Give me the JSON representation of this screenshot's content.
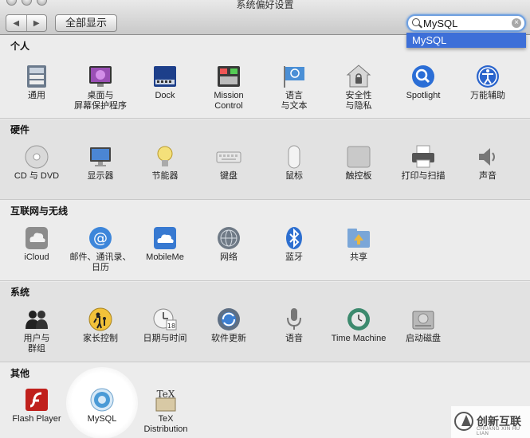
{
  "window": {
    "title": "系统偏好设置"
  },
  "toolbar": {
    "back": "◀",
    "forward": "▶",
    "show_all": "全部显示"
  },
  "search": {
    "value": "MySQL",
    "clear": "×",
    "result": "MySQL"
  },
  "sections": {
    "personal": {
      "title": "个人",
      "items": [
        {
          "label": "通用",
          "icon": "general-icon"
        },
        {
          "label": "桌面与\n屏幕保护程序",
          "icon": "desktop-screensaver-icon"
        },
        {
          "label": "Dock",
          "icon": "dock-icon"
        },
        {
          "label": "Mission\nControl",
          "icon": "mission-control-icon"
        },
        {
          "label": "语言\n与文本",
          "icon": "language-text-icon"
        },
        {
          "label": "安全性\n与隐私",
          "icon": "security-privacy-icon"
        },
        {
          "label": "Spotlight",
          "icon": "spotlight-icon"
        },
        {
          "label": "万能辅助",
          "icon": "accessibility-icon"
        }
      ]
    },
    "hardware": {
      "title": "硬件",
      "items": [
        {
          "label": "CD 与 DVD",
          "icon": "cd-dvd-icon"
        },
        {
          "label": "显示器",
          "icon": "displays-icon"
        },
        {
          "label": "节能器",
          "icon": "energy-saver-icon"
        },
        {
          "label": "键盘",
          "icon": "keyboard-icon"
        },
        {
          "label": "鼠标",
          "icon": "mouse-icon"
        },
        {
          "label": "触控板",
          "icon": "trackpad-icon"
        },
        {
          "label": "打印与扫描",
          "icon": "print-scan-icon"
        },
        {
          "label": "声音",
          "icon": "sound-icon"
        }
      ]
    },
    "internet": {
      "title": "互联网与无线",
      "items": [
        {
          "label": "iCloud",
          "icon": "icloud-icon"
        },
        {
          "label": "邮件、通讯录、\n日历",
          "icon": "mail-contacts-calendars-icon"
        },
        {
          "label": "MobileMe",
          "icon": "mobileme-icon"
        },
        {
          "label": "网络",
          "icon": "network-icon"
        },
        {
          "label": "蓝牙",
          "icon": "bluetooth-icon"
        },
        {
          "label": "共享",
          "icon": "sharing-icon"
        }
      ]
    },
    "system": {
      "title": "系统",
      "items": [
        {
          "label": "用户与\n群组",
          "icon": "users-groups-icon"
        },
        {
          "label": "家长控制",
          "icon": "parental-controls-icon"
        },
        {
          "label": "日期与时间",
          "icon": "date-time-icon"
        },
        {
          "label": "软件更新",
          "icon": "software-update-icon"
        },
        {
          "label": "语音",
          "icon": "speech-icon"
        },
        {
          "label": "Time Machine",
          "icon": "time-machine-icon"
        },
        {
          "label": "启动磁盘",
          "icon": "startup-disk-icon"
        }
      ]
    },
    "other": {
      "title": "其他",
      "items": [
        {
          "label": "Flash Player",
          "icon": "flash-player-icon"
        },
        {
          "label": "MySQL",
          "icon": "mysql-icon"
        },
        {
          "label": "TeX\nDistribution",
          "icon": "tex-distribution-icon"
        }
      ]
    }
  },
  "watermark": {
    "text": "创新互联",
    "sub": "CHUANG XIN HU LIAN"
  }
}
